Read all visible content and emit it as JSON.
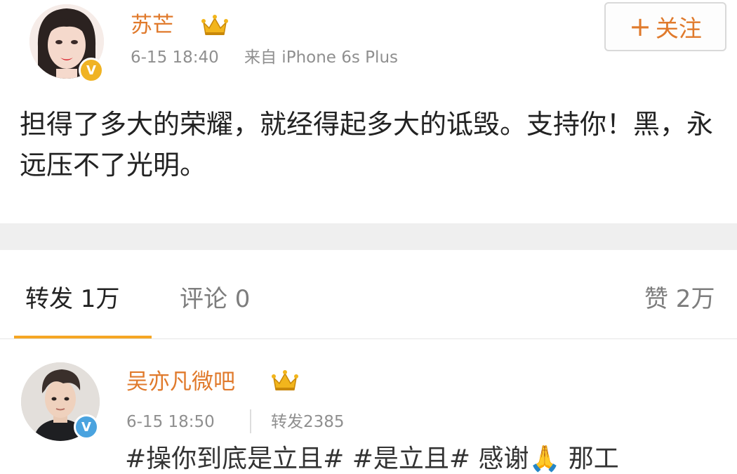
{
  "post": {
    "author": {
      "name": "苏芒",
      "avatar_icon": "female-avatar-icon",
      "badge_icon": "crown-icon",
      "verified_icon": "verified-v-icon"
    },
    "time": "6-15 18:40",
    "source": "来自 iPhone 6s Plus",
    "follow_button": "关注",
    "follow_plus": "+",
    "text": "担得了多大的荣耀，就经得起多大的诋毁。支持你！黑，永远压不了光明。"
  },
  "tabs": {
    "repost": "转发 1万",
    "comment": "评论 0",
    "like": "赞 2万",
    "active": "repost"
  },
  "repost_item": {
    "author": {
      "name": "吴亦凡微吧",
      "avatar_icon": "male-avatar-icon",
      "badge_icon": "crown-icon",
      "verified_icon": "verified-v-icon"
    },
    "time": "6-15 18:50",
    "repost_count": "转发2385",
    "text": "#操你到底是立且# #是立且# 感谢🙏 那工"
  },
  "colors": {
    "username": "#e07a2c",
    "accent_underline": "#f5a623",
    "verified_yellow": "#f0b323",
    "verified_blue": "#4aa3df",
    "gap_band": "#efefef"
  }
}
